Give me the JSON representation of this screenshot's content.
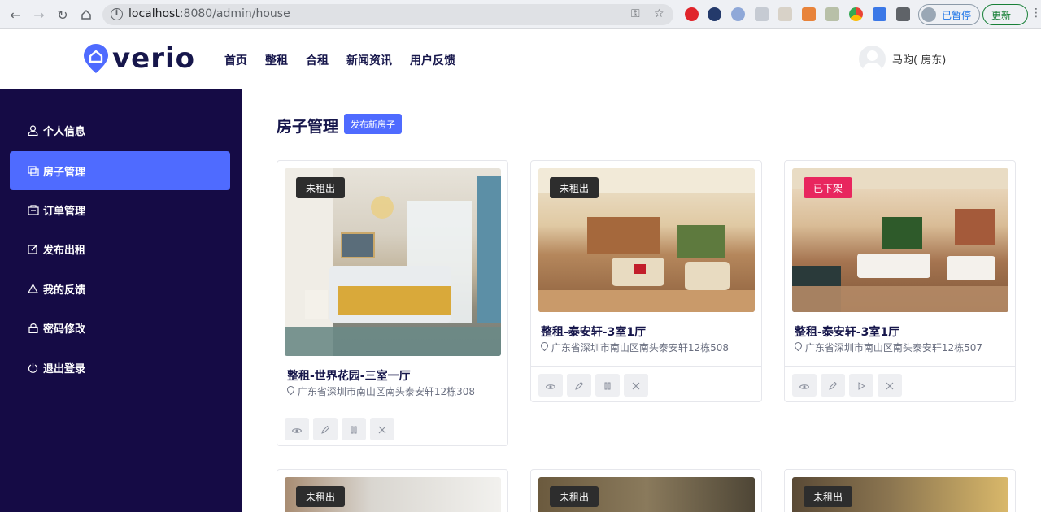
{
  "browser": {
    "url_host": "localhost",
    "url_rest": ":8080/admin/house",
    "profile_status": "已暂停",
    "update_label": "更新"
  },
  "header": {
    "logo_text": "verio",
    "nav": [
      "首页",
      "整租",
      "合租",
      "新闻资讯",
      "用户反馈"
    ],
    "user_name": "马昀( 房东)"
  },
  "sidebar": {
    "items": [
      {
        "label": "个人信息",
        "icon": "user-icon"
      },
      {
        "label": "房子管理",
        "icon": "house-list-icon",
        "active": true
      },
      {
        "label": "订单管理",
        "icon": "orders-icon"
      },
      {
        "label": "发布出租",
        "icon": "edit-icon"
      },
      {
        "label": "我的反馈",
        "icon": "warning-icon"
      },
      {
        "label": "密码修改",
        "icon": "lock-icon"
      },
      {
        "label": "退出登录",
        "icon": "power-icon"
      }
    ]
  },
  "main": {
    "title": "房子管理",
    "publish_label": "发布新房子",
    "cards": [
      {
        "status": "未租出",
        "status_color": "#2d2d2d",
        "title": "整租-世界花园-三室一厅",
        "address": "广东省深圳市南山区南头泰安轩12栋308",
        "toggle_icon": "pause-icon"
      },
      {
        "status": "未租出",
        "status_color": "#2d2d2d",
        "title": "整租-泰安轩-3室1厅",
        "address": "广东省深圳市南山区南头泰安轩12栋508",
        "toggle_icon": "pause-icon"
      },
      {
        "status": "已下架",
        "status_color": "#e8265e",
        "title": "整租-泰安轩-3室1厅",
        "address": "广东省深圳市南山区南头泰安轩12栋507",
        "toggle_icon": "play-icon"
      },
      {
        "status": "未租出",
        "status_color": "#2d2d2d"
      },
      {
        "status": "未租出",
        "status_color": "#2d2d2d"
      },
      {
        "status": "未租出",
        "status_color": "#2d2d2d"
      }
    ]
  }
}
